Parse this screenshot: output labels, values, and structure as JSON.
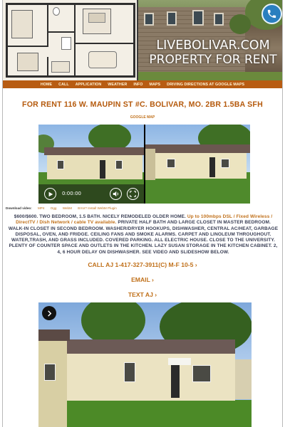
{
  "header": {
    "brand_line1": "LIVEBOLIVAR.COM",
    "brand_line2": "PROPERTY FOR RENT",
    "phone_icon": "phone-icon",
    "accent_color": "#b85c12"
  },
  "nav": {
    "items": [
      "HOME",
      "CALL",
      "APPLICATION",
      "WEATHER",
      "INFO",
      "MAPS",
      "DRIVING DIRECTIONS AT GOOGLE MAPS"
    ]
  },
  "listing": {
    "title": "FOR RENT 116 W. MAUPIN ST #C. BOLIVAR, MO. 2BR 1.5BA SFH",
    "map_link": "GOOGLE MAP"
  },
  "video": {
    "time": "0:00:00",
    "play_icon": "play-icon",
    "volume_icon": "volume-icon",
    "fullscreen_icon": "fullscreen-icon"
  },
  "downloads": {
    "label": "Download video:",
    "links": [
      "MP4",
      "Ogg",
      "WebM"
    ],
    "note": "Error? Install WebM Plugin"
  },
  "description": {
    "part1": "$600/$600. TWO BEDROOM, 1.5 BATH. NICELY REMODELED OLDER HOME. ",
    "part2": "Up to 100mbps DSL / Fixed Wireless / DirectTV / Dish Network / cable TV available.",
    "part3": " PRIVATE HALF BATH AND LARGE CLOSET IN MASTER BEDROOM. WALK-IN CLOSET IN SECOND BEDROOM. WASHER/DRYER HOOKUPS, DISHWASHER, CENTRAL AC/HEAT, GARBAGE DISPOSAL, OVEN, AND FRIDGE. CEILING FANS AND SMOKE ALARMS. CARPET AND LINOLEUM THROUGHOUT. WATER,TRASH, AND GRASS INCLUDED. COVERED PARKING. ALL ELECTRIC HOUSE. CLOSE TO THE UNIVERSITY. PLENTY OF COUNTER SPACE AND OUTLETS IN THE KITCHEN. LAZY SUSAN STORAGE IN THE KITCHEN CABINET. 2, 4, 6 HOUR DELAY ON DISHWASHER. SEE VIDEO AND SLIDESHOW BELOW."
  },
  "contact": {
    "call": "CALL AJ 1-417-327-3911(C) M-F 10-5 ›",
    "email": "EMAIL ›",
    "text": "TEXT AJ ›"
  },
  "gallery": {
    "arrow_icon": "chevron-right-icon"
  }
}
